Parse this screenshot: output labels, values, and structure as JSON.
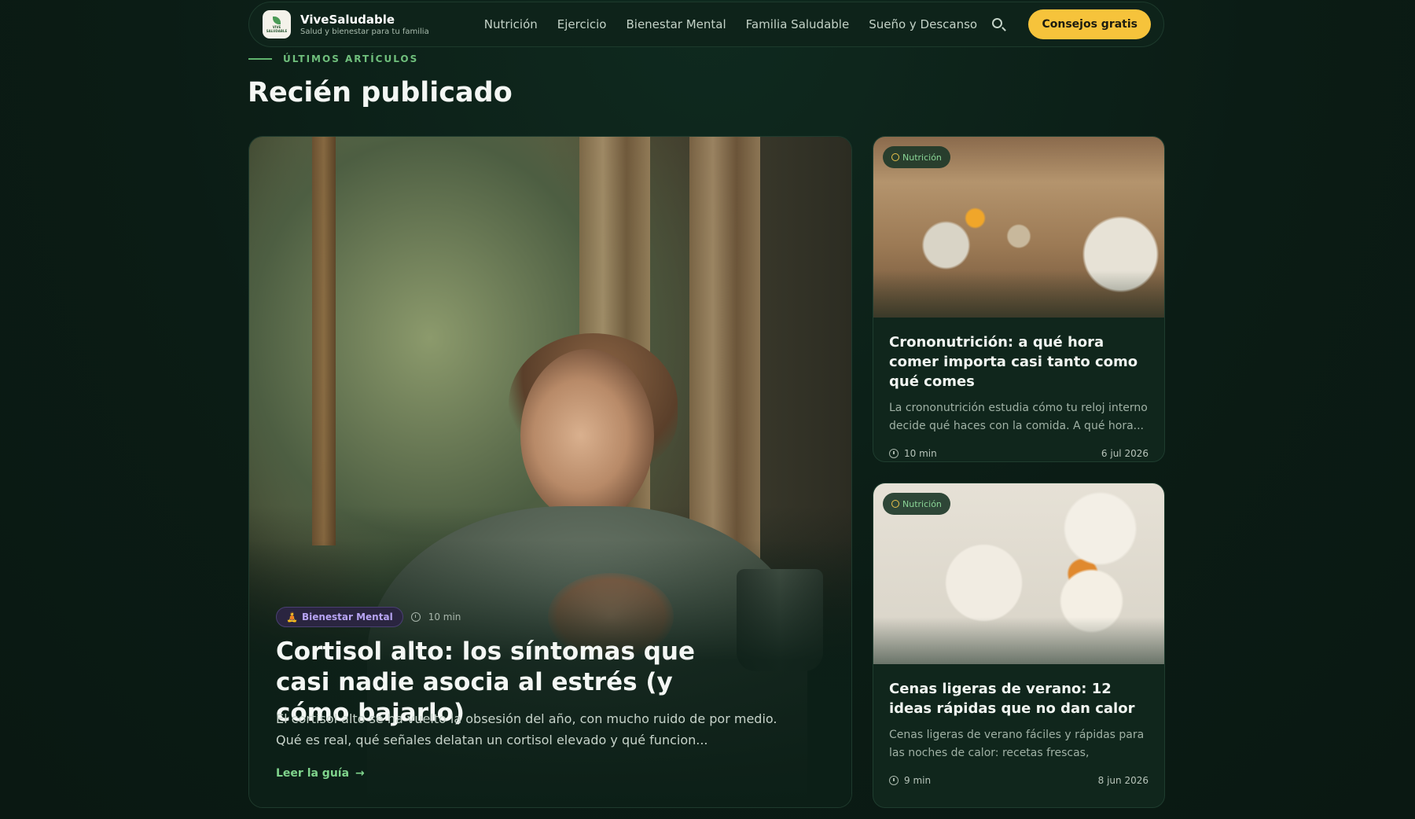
{
  "nav": {
    "brand_name": "ViveSaludable",
    "brand_tagline": "Salud y bienestar para tu familia",
    "logo_mini_text": "VIVE SALUDABLE",
    "links": [
      "Nutrición",
      "Ejercicio",
      "Bienestar Mental",
      "Familia Saludable",
      "Sueño y Descanso"
    ],
    "search_icon": "search-icon",
    "cta_label": "Consejos gratis"
  },
  "section": {
    "eyebrow": "ÚLTIMOS ARTÍCULOS",
    "title": "Recién publicado"
  },
  "featured": {
    "category": "Bienestar Mental",
    "category_icon": "meditation-icon",
    "read_time": "10 min",
    "title": "Cortisol alto: los síntomas que casi nadie asocia al estrés (y cómo bajarlo)",
    "description": "El cortisol alto se ha vuelto la obsesión del año, con mucho ruido de por medio. Qué es real, qué señales delatan un cortisol elevado y qué funcion...",
    "link_label": "Leer la guía",
    "link_arrow": "→"
  },
  "cards": [
    {
      "category": "Nutrición",
      "title": "Crononutrición: a qué hora comer importa casi tanto como qué comes",
      "description": "La crononutrición estudia cómo tu reloj interno decide qué haces con la comida. A qué hora...",
      "read_time": "10 min",
      "date": "6 jul 2026"
    },
    {
      "category": "Nutrición",
      "title": "Cenas ligeras de verano: 12 ideas rápidas que no dan calor",
      "description": "Cenas ligeras de verano fáciles y rápidas para las noches de calor: recetas frescas, saciante...",
      "read_time": "9 min",
      "date": "8 jun 2026"
    }
  ],
  "colors": {
    "background": "#0b1c15",
    "accent_green": "#7fd38c",
    "cta_yellow": "#f6c33b",
    "mental_purple": "#b7a4f3"
  }
}
